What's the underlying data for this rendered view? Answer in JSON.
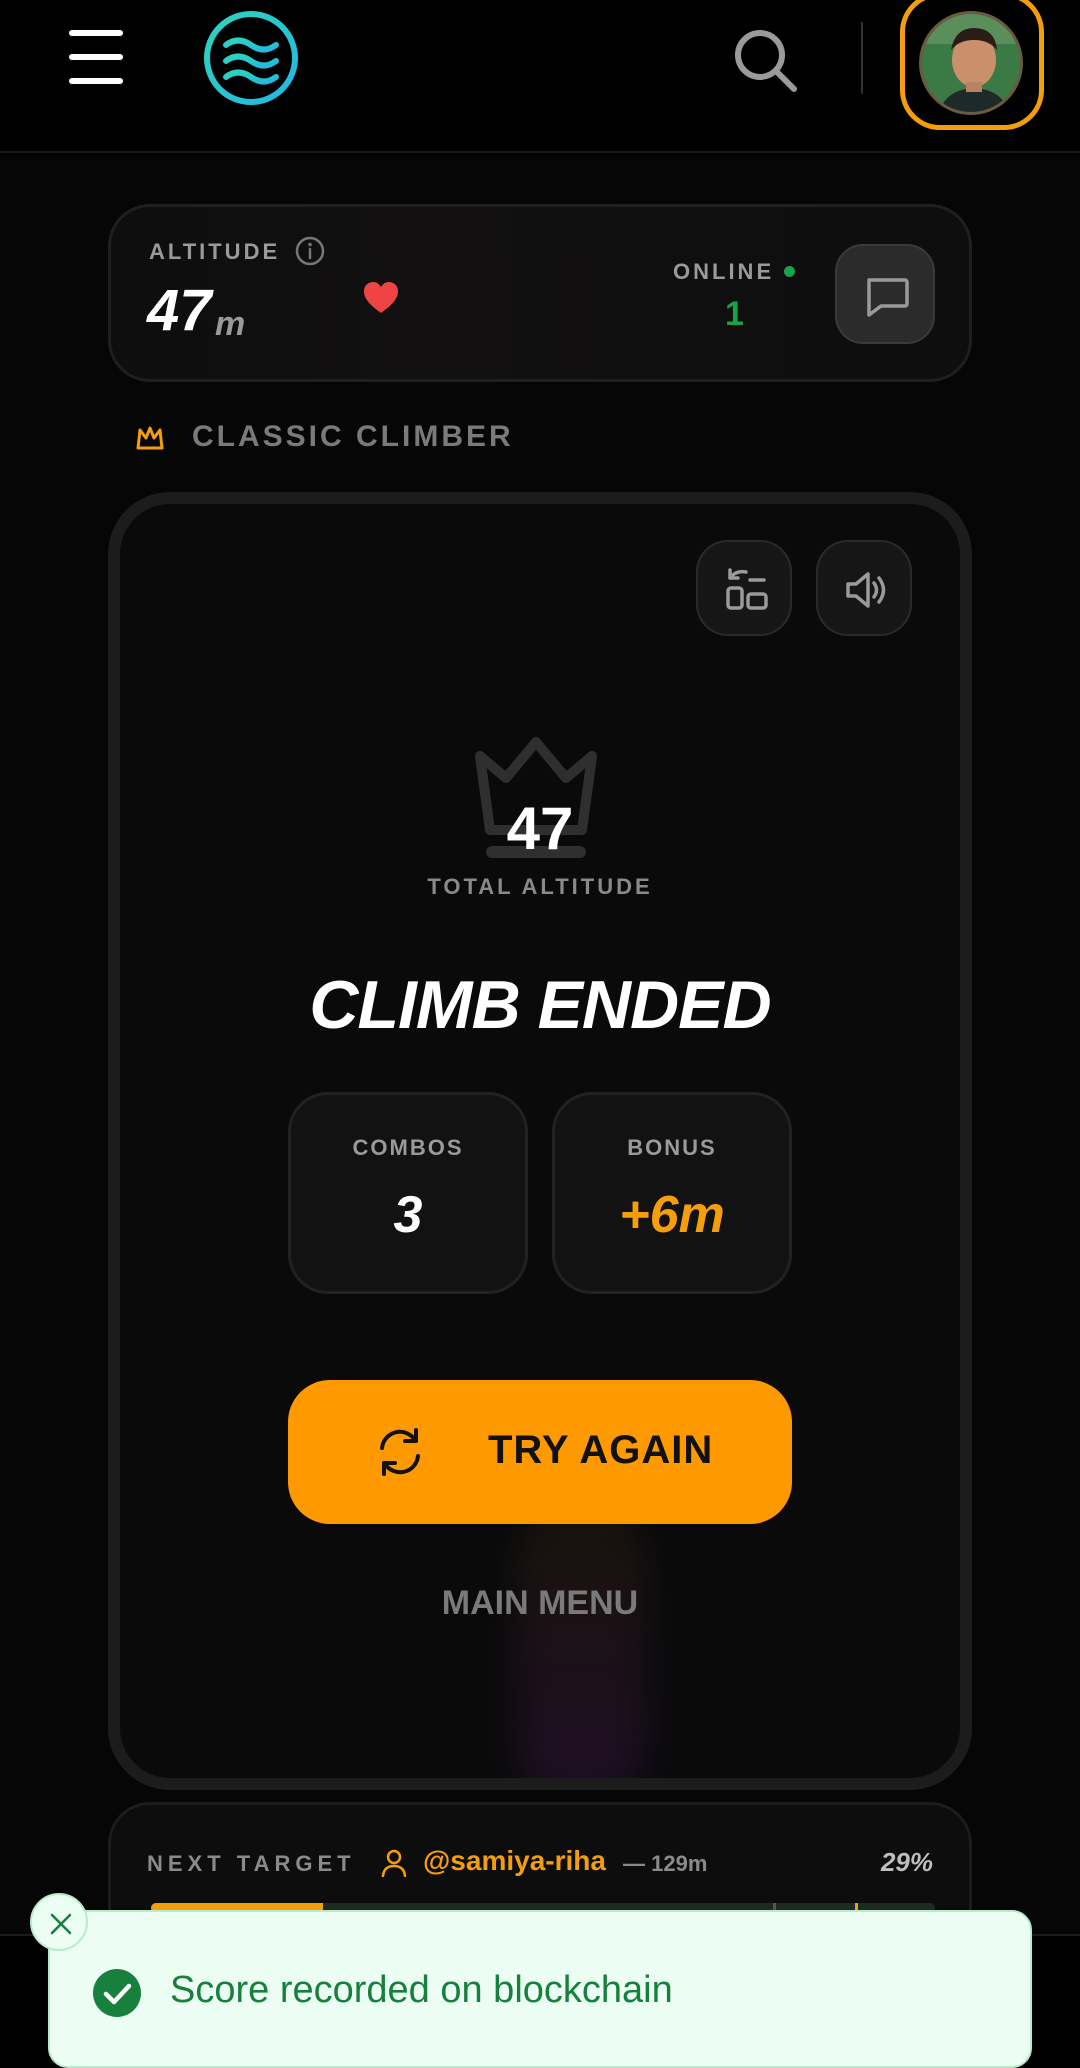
{
  "header": {
    "menu_icon": "hamburger-menu-icon",
    "logo_icon": "waves-logo-icon",
    "search_icon": "search-icon",
    "avatar": "user-avatar",
    "accent_color": "#f59e0b"
  },
  "altitude_card": {
    "label": "ALTITUDE",
    "value": "47",
    "unit": "m",
    "online_label": "ONLINE",
    "online_count": "1",
    "online_color": "#16a34a",
    "heart_color": "#ef4444"
  },
  "mode": {
    "label": "CLASSIC CLIMBER"
  },
  "result": {
    "score": "47",
    "score_label": "TOTAL ALTITUDE",
    "title": "CLIMB ENDED",
    "stats": [
      {
        "label": "COMBOS",
        "value": "3",
        "color": "#ffffff"
      },
      {
        "label": "BONUS",
        "value": "+6m",
        "color": "#f59e0b"
      }
    ],
    "try_again_label": "TRY AGAIN",
    "main_menu_label": "MAIN MENU",
    "primary_color": "#ff9900"
  },
  "next_target": {
    "label": "NEXT TARGET",
    "user": "@samiya-riha",
    "distance": "— 129m",
    "percent": "29%",
    "progress": 0.22
  },
  "toast": {
    "message": "Score recorded on blockchain",
    "color": "#16803c"
  }
}
